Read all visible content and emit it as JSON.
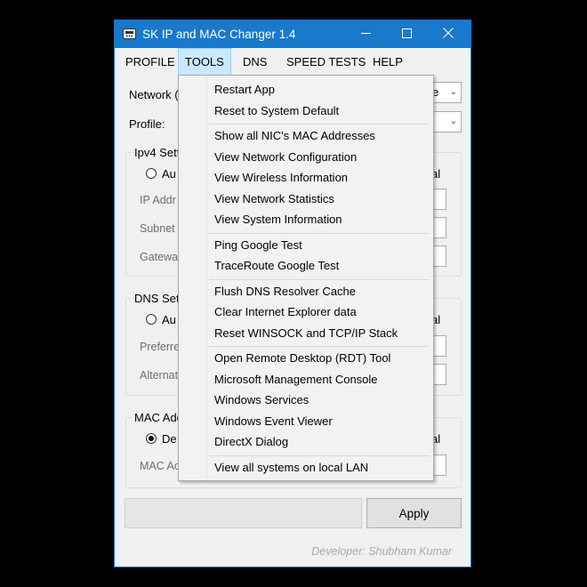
{
  "window": {
    "title": "SK IP and MAC Changer 1.4",
    "accent_color": "#1979ca",
    "icons": {
      "app": "network-card-icon",
      "minimize": "minimize-icon",
      "maximize": "maximize-icon",
      "close": "close-icon"
    }
  },
  "menu": {
    "items": [
      "PROFILE",
      "TOOLS",
      "DNS",
      "SPEED TESTS",
      "HELP"
    ],
    "active": "TOOLS"
  },
  "form": {
    "network_label": "Network (",
    "network_value": "e",
    "profile_label": "Profile:",
    "ipv4": {
      "title": "Ipv4 Sett",
      "auto_label": "Au",
      "manual_label": "al",
      "ip_label": "IP Addr",
      "subnet_label": "Subnet",
      "gateway_label": "Gatewa"
    },
    "dns": {
      "title": "DNS Sett",
      "auto_label": "Au",
      "manual_label": "al",
      "preferred_label": "Preferre",
      "alternate_label": "Alternat"
    },
    "mac": {
      "title": "MAC Add",
      "default_label": "De",
      "manual_label": "al",
      "mac_label": "MAC Ac"
    },
    "apply_label": "Apply",
    "developer": "Developer: Shubham Kumar"
  },
  "tools_menu": {
    "groups": [
      [
        "Restart App",
        "Reset to System Default"
      ],
      [
        "Show all NIC's MAC Addresses",
        "View Network Configuration",
        "View Wireless Information",
        "View Network Statistics",
        "View System Information"
      ],
      [
        "Ping Google Test",
        "TraceRoute Google Test"
      ],
      [
        "Flush DNS Resolver Cache",
        "Clear Internet Explorer data",
        "Reset WINSOCK and TCP/IP Stack"
      ],
      [
        "Open Remote Desktop (RDT) Tool",
        "Microsoft Management Console",
        "Windows Services",
        "Windows Event Viewer",
        "DirectX Dialog"
      ],
      [
        "View all systems on local LAN"
      ]
    ]
  }
}
